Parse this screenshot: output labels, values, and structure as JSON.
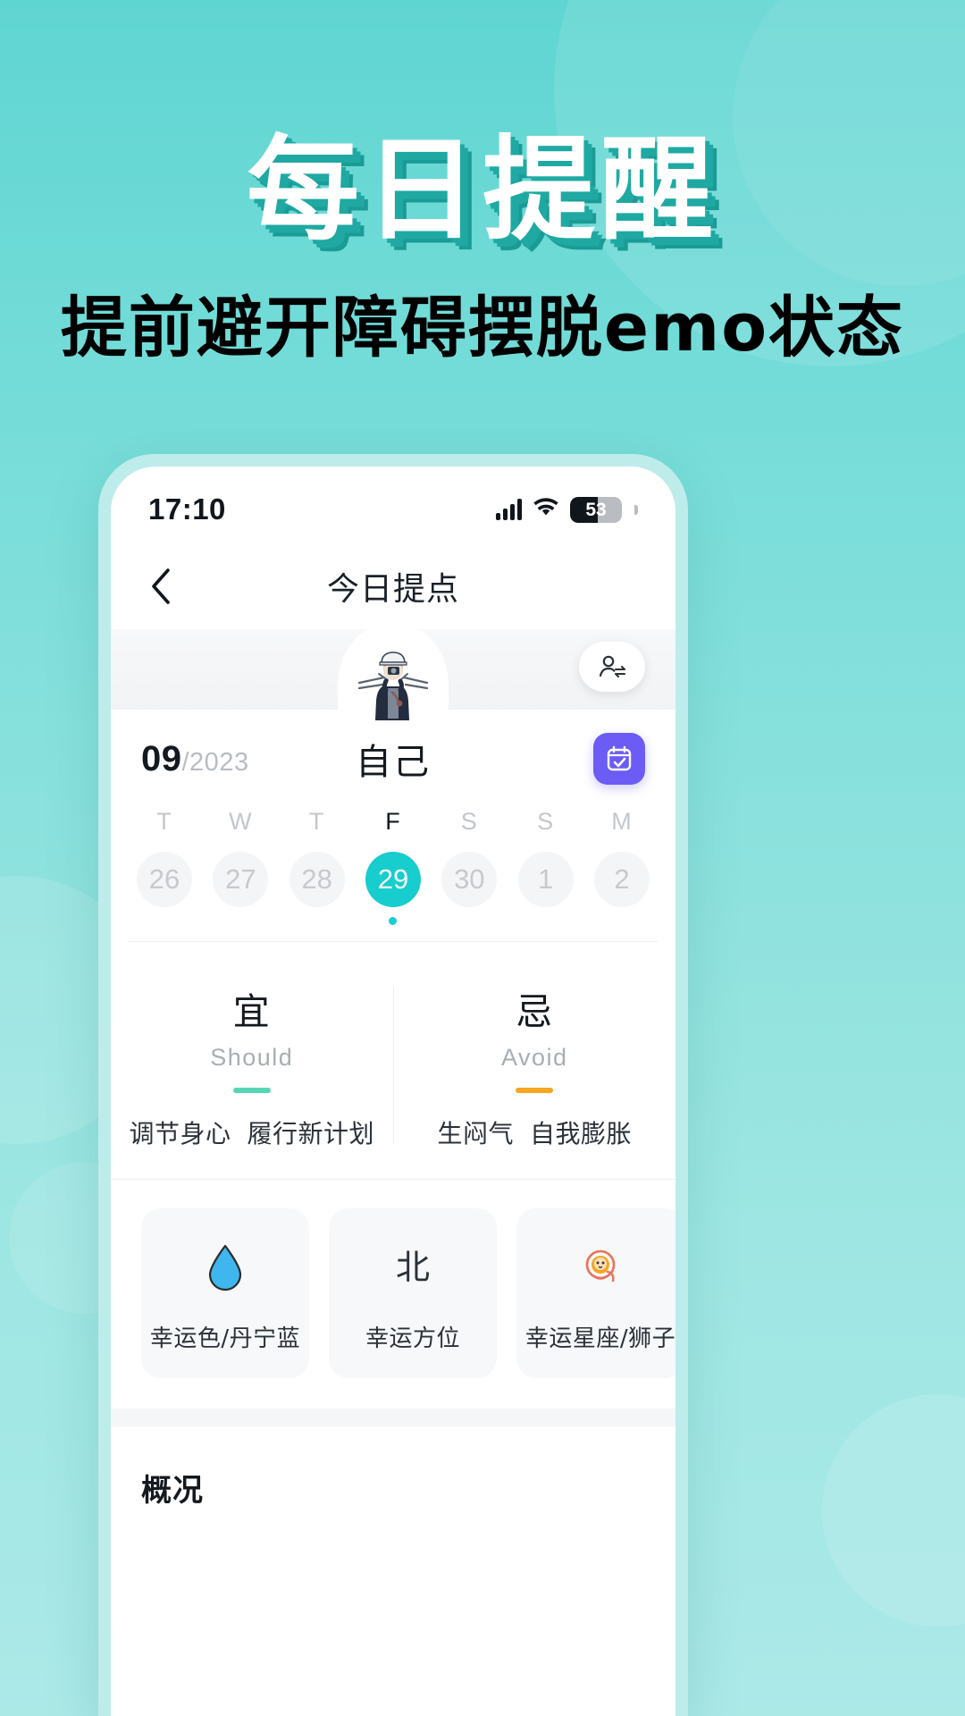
{
  "poster": {
    "headline": "每日提醒",
    "subtitle_yellow": "提前避开障碍",
    "subtitle_white": "摆脱emo状态",
    "colors": {
      "bg_top": "#5fd5d2",
      "bg_bottom": "#abe9e7",
      "headline_text": "#ffffff",
      "headline_shadow": "#1fa9a2",
      "subtitle_yellow": "#f7e825"
    }
  },
  "phone": {
    "status_bar": {
      "time": "17:10",
      "battery_level": "53",
      "signal_icon": "signal-bars-icon",
      "wifi_icon": "wifi-icon",
      "battery_icon": "battery-icon"
    },
    "nav": {
      "back_icon": "back-chevron-icon",
      "title": "今日提点"
    },
    "profile": {
      "avatar_icon": "avatar-illustration",
      "switch_person_icon": "person-switch-icon",
      "name": "自己"
    },
    "date": {
      "month": "09",
      "year": "/2023",
      "calendar_icon": "calendar-check-icon",
      "calendar_accent": "#6c5cf5"
    },
    "week": {
      "days": [
        {
          "dow": "T",
          "num": "26",
          "active": false
        },
        {
          "dow": "W",
          "num": "27",
          "active": false
        },
        {
          "dow": "T",
          "num": "28",
          "active": false
        },
        {
          "dow": "F",
          "num": "29",
          "active": true
        },
        {
          "dow": "S",
          "num": "30",
          "active": false
        },
        {
          "dow": "S",
          "num": "1",
          "active": false
        },
        {
          "dow": "M",
          "num": "2",
          "active": false
        }
      ],
      "selected_color": "#17cdcd"
    },
    "should_avoid": {
      "should": {
        "cn": "宜",
        "en": "Should",
        "bar_color": "#57d6b4",
        "items": [
          "调节身心",
          "履行新计划"
        ]
      },
      "avoid": {
        "cn": "忌",
        "en": "Avoid",
        "bar_color": "#f5a623",
        "items": [
          "生闷气",
          "自我膨胀"
        ]
      }
    },
    "lucky_cards": [
      {
        "glyph": "💧",
        "glyph_name": "water-drop-icon",
        "label": "幸运色/丹宁蓝"
      },
      {
        "glyph": "北",
        "glyph_name": "direction-north-text",
        "label": "幸运方位"
      },
      {
        "glyph": "🦁",
        "glyph_name": "lion-zodiac-icon",
        "label": "幸运星座/狮子"
      }
    ],
    "overview": {
      "title": "概况"
    }
  }
}
